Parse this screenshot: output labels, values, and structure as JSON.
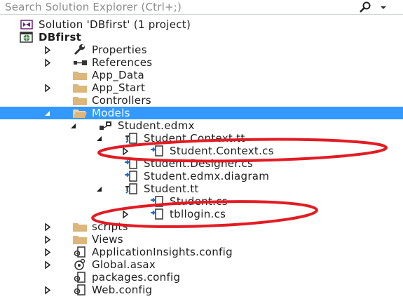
{
  "search": {
    "placeholder": "Search Solution Explorer (Ctrl+;)",
    "icon": "search-icon",
    "dropdown_icon": "chevron-down-icon"
  },
  "colors": {
    "selection": "#3399ff",
    "annotation": "#e31b23",
    "folder": "#dcb67a"
  },
  "tree": [
    {
      "label": "Solution 'DBfirst' (1 project)",
      "icon": "solution-icon",
      "depth": 0,
      "expander": "none",
      "bold": false,
      "selected": false
    },
    {
      "label": "DBfirst",
      "icon": "web-project-icon",
      "depth": 0,
      "expander": "expanded",
      "bold": true,
      "selected": false
    },
    {
      "label": "Properties",
      "icon": "wrench-icon",
      "depth": 1,
      "expander": "collapsed",
      "bold": false,
      "selected": false
    },
    {
      "label": "References",
      "icon": "references-icon",
      "depth": 1,
      "expander": "collapsed",
      "bold": false,
      "selected": false
    },
    {
      "label": "App_Data",
      "icon": "folder-icon",
      "depth": 1,
      "expander": "none",
      "bold": false,
      "selected": false
    },
    {
      "label": "App_Start",
      "icon": "folder-icon",
      "depth": 1,
      "expander": "collapsed",
      "bold": false,
      "selected": false
    },
    {
      "label": "Controllers",
      "icon": "folder-icon",
      "depth": 1,
      "expander": "none",
      "bold": false,
      "selected": false
    },
    {
      "label": "Models",
      "icon": "open-folder-icon",
      "depth": 1,
      "expander": "expanded",
      "bold": false,
      "selected": true
    },
    {
      "label": "Student.edmx",
      "icon": "edmx-icon",
      "depth": 2,
      "expander": "expanded",
      "bold": false,
      "selected": false
    },
    {
      "label": "Student.Context.tt",
      "icon": "t4-template-icon",
      "depth": 3,
      "expander": "expanded",
      "bold": false,
      "selected": false
    },
    {
      "label": "Student.Context.cs",
      "icon": "cs-file-icon",
      "depth": 4,
      "expander": "collapsed",
      "bold": false,
      "selected": false,
      "highlighted": true
    },
    {
      "label": "Student.Designer.cs",
      "icon": "cs-file-icon",
      "depth": 3,
      "expander": "none",
      "bold": false,
      "selected": false
    },
    {
      "label": "Student.edmx.diagram",
      "icon": "diagram-file-icon",
      "depth": 3,
      "expander": "none",
      "bold": false,
      "selected": false
    },
    {
      "label": "Student.tt",
      "icon": "t4-template-icon",
      "depth": 3,
      "expander": "expanded",
      "bold": false,
      "selected": false
    },
    {
      "label": "Student.cs",
      "icon": "cs-file-icon",
      "depth": 4,
      "expander": "none",
      "bold": false,
      "selected": false
    },
    {
      "label": "tbllogin.cs",
      "icon": "cs-file-icon",
      "depth": 4,
      "expander": "collapsed",
      "bold": false,
      "selected": false,
      "highlighted": true
    },
    {
      "label": "scripts",
      "icon": "folder-icon",
      "depth": 1,
      "expander": "collapsed",
      "bold": false,
      "selected": false
    },
    {
      "label": "Views",
      "icon": "folder-icon",
      "depth": 1,
      "expander": "collapsed",
      "bold": false,
      "selected": false
    },
    {
      "label": "ApplicationInsights.config",
      "icon": "config-file-icon",
      "depth": 1,
      "expander": "collapsed",
      "bold": false,
      "selected": false
    },
    {
      "label": "Global.asax",
      "icon": "global-asax-icon",
      "depth": 1,
      "expander": "collapsed",
      "bold": false,
      "selected": false
    },
    {
      "label": "packages.config",
      "icon": "config-file-icon",
      "depth": 1,
      "expander": "none",
      "bold": false,
      "selected": false
    },
    {
      "label": "Web.config",
      "icon": "config-file-icon",
      "depth": 1,
      "expander": "collapsed",
      "bold": false,
      "selected": false
    }
  ]
}
